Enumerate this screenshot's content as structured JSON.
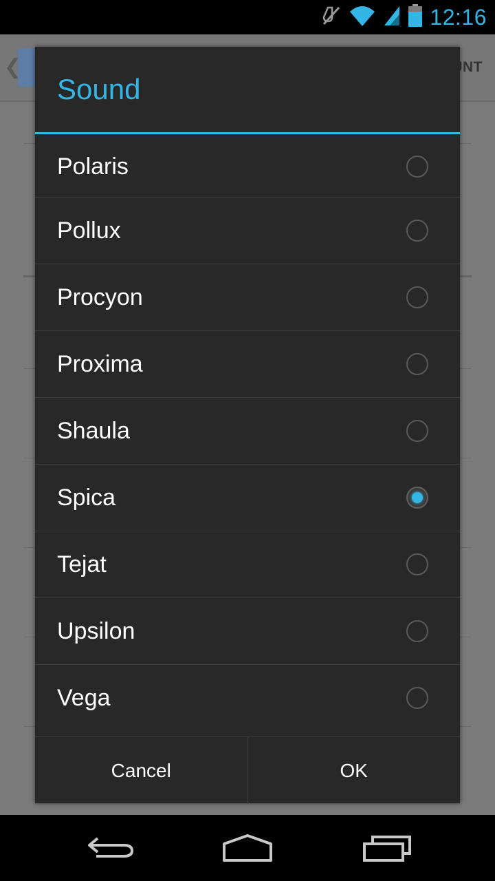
{
  "status_bar": {
    "time": "12:16",
    "icons": [
      "muted-icon",
      "wifi-icon",
      "signal-icon",
      "battery-icon"
    ]
  },
  "background": {
    "action_bar_text": "UNT"
  },
  "dialog": {
    "title": "Sound",
    "options": [
      {
        "label": "Polaris",
        "checked": false
      },
      {
        "label": "Pollux",
        "checked": false
      },
      {
        "label": "Procyon",
        "checked": false
      },
      {
        "label": "Proxima",
        "checked": false
      },
      {
        "label": "Shaula",
        "checked": false
      },
      {
        "label": "Spica",
        "checked": true
      },
      {
        "label": "Tejat",
        "checked": false
      },
      {
        "label": "Upsilon",
        "checked": false
      },
      {
        "label": "Vega",
        "checked": false
      }
    ],
    "cancel_label": "Cancel",
    "ok_label": "OK"
  },
  "nav_bar": {
    "icons": [
      "back-icon",
      "home-icon",
      "recents-icon"
    ]
  },
  "colors": {
    "accent": "#33b5e5",
    "dialog_bg": "#282828",
    "scrim": "#7a7a7a"
  }
}
